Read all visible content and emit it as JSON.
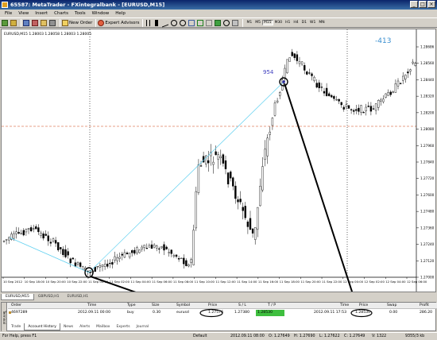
{
  "window": {
    "title": "65587: MetaTrader - FXintegralbank - [EURUSD,M15]"
  },
  "menu": [
    "File",
    "View",
    "Insert",
    "Charts",
    "Tools",
    "Window",
    "Help"
  ],
  "toolbar": {
    "new_order": "New Order",
    "expert_advisors": "Expert Advisors",
    "timeframes": [
      "M1",
      "M5",
      "M15",
      "M30",
      "H1",
      "H4",
      "D1",
      "W1",
      "MN"
    ],
    "active_timeframe": "M15"
  },
  "chart": {
    "symbol_header": "EURUSD,M15  1.28003 1.28058 1.28003 1.28005",
    "annotation_left": "954",
    "annotation_right": "-413",
    "price_labels": [
      "1.28686",
      "1.28560",
      "1.28440",
      "1.28320",
      "1.28200",
      "1.28080",
      "1.27960",
      "1.27840",
      "1.27720",
      "1.27600",
      "1.27480",
      "1.27360",
      "1.27240",
      "1.27120",
      "1.27000"
    ],
    "time_labels": [
      "10 Sep 2012",
      "10 Sep 18:00",
      "10 Sep 20:00",
      "10 Sep 22:00",
      "11 Sep 00:00",
      "11 Sep 02:00",
      "11 Sep 04:00",
      "11 Sep 06:00",
      "11 Sep 08:00",
      "11 Sep 10:00",
      "11 Sep 12:00",
      "11 Sep 14:00",
      "11 Sep 16:00",
      "11 Sep 18:00",
      "11 Sep 20:00",
      "11 Sep 22:00",
      "12 Sep 00:00",
      "12 Sep 02:00",
      "12 Sep 04:00",
      "12 Sep 06:00"
    ],
    "colors": {
      "candle": "#000000",
      "trend_line": "#5fd0f0",
      "level_line": "#e08060",
      "annotation": "#4040c0",
      "annotation_right": "#3a8fd0"
    }
  },
  "chart_tabs": [
    "EURUSD,M15",
    "GBPUSD,H1",
    "EURUSD,H1"
  ],
  "terminal": {
    "headers": [
      "Order",
      "Time",
      "Type",
      "Size",
      "Symbol",
      "Price",
      "S / L",
      "T / P",
      "Time",
      "Price",
      "Swap",
      "Profit"
    ],
    "row": {
      "order": "4697289",
      "open_time": "2012.09.11 00:00",
      "type": "buy",
      "size": "0.30",
      "symbol": "eurusd",
      "price": "1.27576",
      "sl": "1.27380",
      "tp": "1.28530",
      "close_time": "2012.09.11 17:53",
      "close_price": "1.28530",
      "swap": "0.00",
      "profit": "286.20"
    },
    "tabs": [
      "Trade",
      "Account History",
      "News",
      "Alerts",
      "Mailbox",
      "Experts",
      "Journal"
    ],
    "active_tab": "Account History",
    "side_label": "Terminal"
  },
  "status": {
    "help": "For Help, press F1",
    "profile": "Default",
    "datetime": "2012.09.11 08:00",
    "open": "O: 1.27649",
    "high": "H: 1.27690",
    "low": "L: 1.27622",
    "close": "C: 1.27649",
    "volume": "V: 1322",
    "traffic": "9355/3 kb"
  }
}
